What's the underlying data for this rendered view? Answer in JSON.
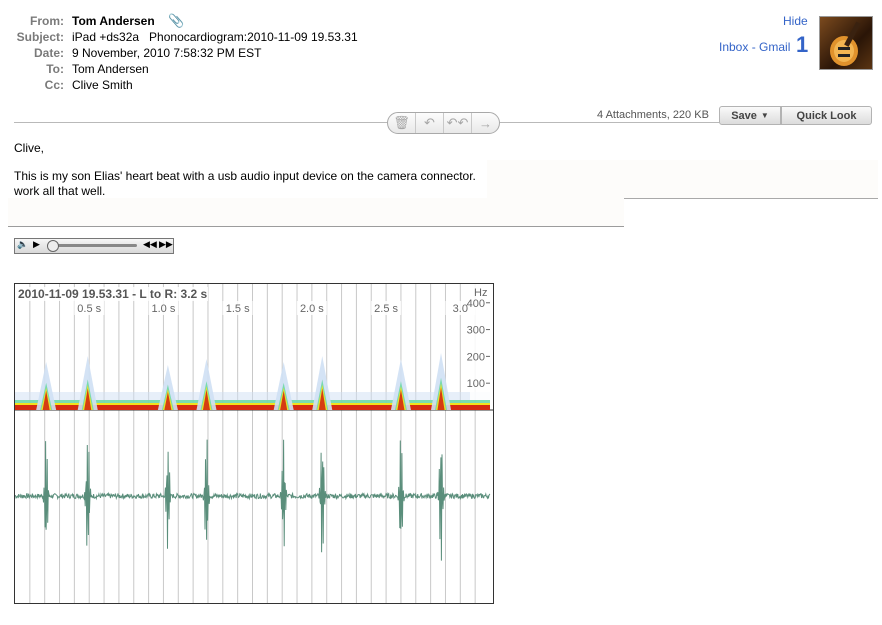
{
  "header": {
    "from_label": "From:",
    "from_value": "Tom Andersen",
    "subject_label": "Subject:",
    "subject_value": "iPad +ds32a   Phonocardiogram:2010-11-09 19.53.31",
    "date_label": "Date:",
    "date_value": "9 November, 2010 7:58:32 PM EST",
    "to_label": "To:",
    "to_value": "Tom Andersen",
    "cc_label": "Cc:",
    "cc_value": "Clive Smith",
    "hide_link": "Hide",
    "inbox_link": "Inbox - Gmail",
    "inbox_count": "1"
  },
  "attachments": {
    "summary": "4 Attachments, 220 KB",
    "save_label": "Save",
    "quicklook_label": "Quick Look"
  },
  "body": {
    "greeting": "Clive,",
    "line1": "This is my son Elias' heart beat with a usb audio input device on the camera connector. ",
    "line2": "work all that well."
  },
  "chart_data": {
    "type": "spectrogram-waveform",
    "title": "2010-11-09 19.53.31 - L to R: 3.2 s",
    "x_ticks": [
      "0.5 s",
      "1.0 s",
      "1.5 s",
      "2.0 s",
      "2.5 s",
      "3.0"
    ],
    "x_tick_values": [
      0.5,
      1.0,
      1.5,
      2.0,
      2.5,
      3.0
    ],
    "xlim": [
      0,
      3.2
    ],
    "y_unit": "Hz",
    "y_ticks": [
      "400",
      "300",
      "200",
      "100"
    ],
    "y_tick_values": [
      400,
      300,
      200,
      100
    ],
    "ylim": [
      0,
      470
    ],
    "beat_times": [
      0.21,
      0.49,
      1.03,
      1.29,
      1.81,
      2.07,
      2.6,
      2.87
    ],
    "beat_strength": [
      0.8,
      0.9,
      0.75,
      0.85,
      0.8,
      0.9,
      0.85,
      0.95
    ],
    "colors": {
      "wave": "#5a8e7b",
      "hot": "#d42a10",
      "warm": "#f2e21c",
      "cool": "#6ed8a8",
      "cold": "#cfe0f4"
    }
  }
}
